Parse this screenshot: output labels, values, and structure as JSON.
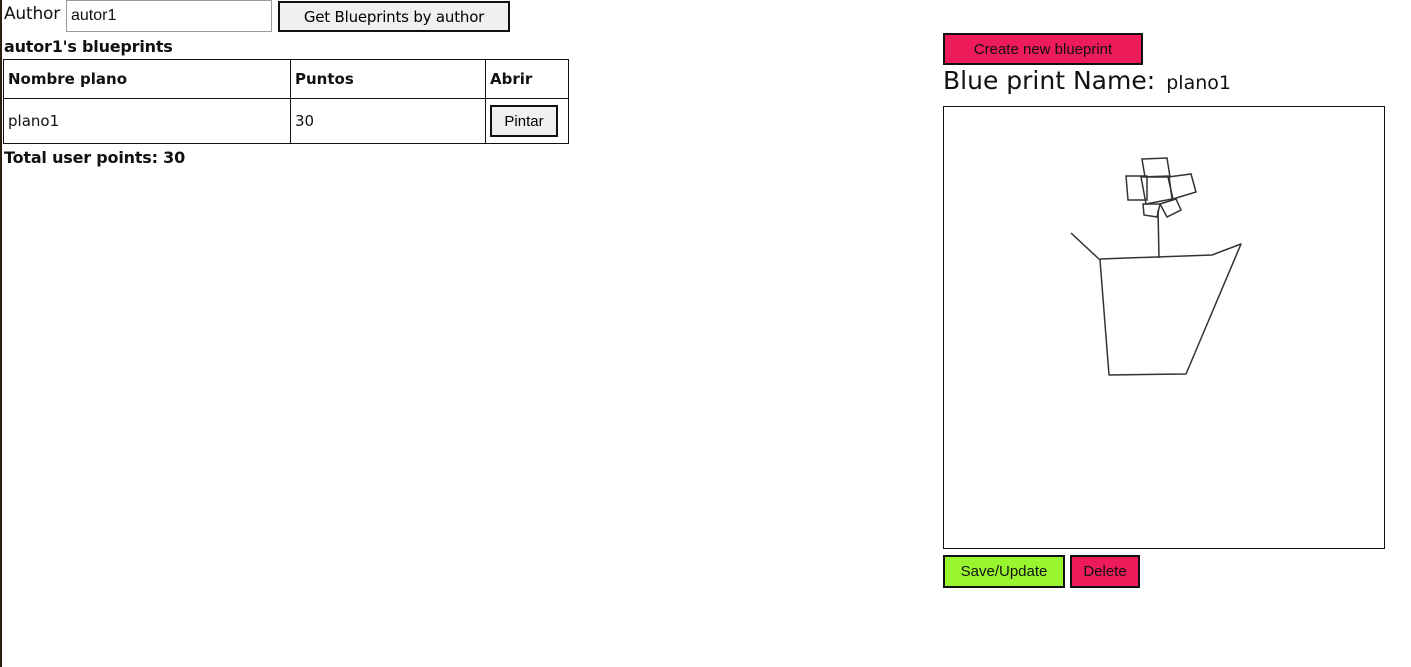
{
  "search": {
    "author_label": "Author",
    "author_value": "autor1",
    "get_button_label": "Get Blueprints by author"
  },
  "list": {
    "title": "autor1's blueprints",
    "columns": [
      "Nombre plano",
      "Puntos",
      "Abrir"
    ],
    "rows": [
      {
        "name": "plano1",
        "points": "30",
        "action_label": "Pintar"
      }
    ],
    "total_label": "Total user points: 30"
  },
  "editor": {
    "create_button_label": "Create new blueprint",
    "name_label": "Blue print Name:",
    "name_value": "plano1",
    "save_button_label": "Save/Update",
    "delete_button_label": "Delete"
  },
  "colors": {
    "create_button": "#ee1b5a",
    "save_button": "#99f52f",
    "delete_button": "#ee1b5a"
  }
}
